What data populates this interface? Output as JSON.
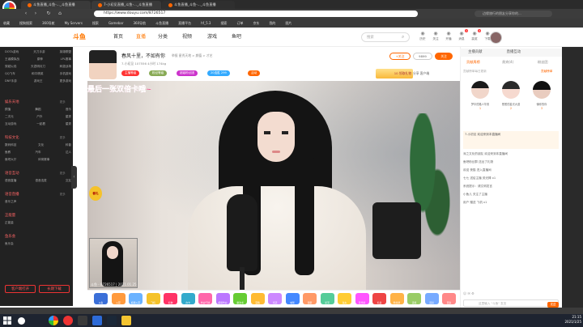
{
  "browser": {
    "tabs": [
      {
        "label": "斗鱼直播_斗鱼-..._斗鱼直播",
        "active": false
      },
      {
        "label": "斗鱼直播_斗鱼-..._斗鱼直播",
        "active": false
      },
      {
        "label": "7-小初见直播_斗鱼-..._斗鱼直播",
        "active": true
      },
      {
        "label": "斗鱼直播_斗鱼-..._斗鱼直播",
        "active": false
      }
    ],
    "url": "https://www.douyu.com/8726517",
    "search_placeholder": "边缘旅行的朋友分享你的...",
    "bookmarks": [
      "收藏",
      "搜狗搜索",
      "360导航",
      "My Servers",
      "搜索",
      "Gamebar",
      "360导航",
      "斗鱼直播",
      "直播平台",
      "hf_5.3",
      "搜索",
      "订单",
      "京东",
      "我的",
      "图片"
    ]
  },
  "site": {
    "logo": "斗鱼",
    "nav": [
      {
        "label": "首页",
        "active": false
      },
      {
        "label": "直播",
        "active": true
      },
      {
        "label": "分类",
        "active": false
      },
      {
        "label": "视频",
        "active": false
      },
      {
        "label": "游戏",
        "active": false
      },
      {
        "label": "鱼吧",
        "active": false
      }
    ],
    "search_placeholder": "搜索",
    "header_icons": [
      {
        "icon": "history-icon",
        "label": "历史"
      },
      {
        "icon": "follow-icon",
        "label": "关注"
      },
      {
        "icon": "live-icon",
        "label": "开播"
      },
      {
        "icon": "message-icon",
        "label": "消息",
        "badge": "1"
      },
      {
        "icon": "task-icon",
        "label": "赢奖",
        "badge": "4"
      },
      {
        "icon": "download-icon",
        "label": "下载"
      }
    ]
  },
  "left_sidebar": {
    "top_rows": [
      [
        "DOTA游戏",
        "天刀手游",
        "英雄联盟"
      ],
      [
        "王者模拟战",
        "原神",
        "LPL赛事"
      ],
      [
        "穿越火线",
        "天涯明月刀",
        "刺激战场"
      ],
      [
        "QQ飞车",
        "和平精英",
        "手机游戏"
      ],
      [
        "DNF手游",
        "游戏王",
        "更多游戏"
      ]
    ],
    "sections": [
      {
        "title": "娱乐天地",
        "more": "更多",
        "rows": [
          [
            "颜值",
            "舞蹈",
            "音乐"
          ],
          [
            "二次元",
            "户外",
            "星秀"
          ],
          [
            "互动游戏",
            "一起看",
            "星秀"
          ]
        ]
      },
      {
        "title": "科技文化",
        "more": "更多",
        "rows": [
          [
            "数码科技",
            "文化",
            "科普"
          ],
          [
            "鱼教",
            "汽车",
            "达人"
          ],
          [
            "鱼吧大厅",
            "体育赛事",
            ""
          ]
        ]
      },
      {
        "title": "语音互动",
        "more": "更多",
        "rows": [
          [
            "语音直播",
            "语音连麦",
            "交友"
          ]
        ]
      },
      {
        "title": "语音直播",
        "more": "更多",
        "rows": [
          [
            "音乐之声",
            "",
            ""
          ]
        ]
      },
      {
        "title": "正能量",
        "more": "",
        "rows": [
          [
            "正能量",
            "",
            ""
          ]
        ]
      },
      {
        "title": "鱼乐会",
        "more": "",
        "rows": [
          [
            "鱼乐会",
            "",
            ""
          ]
        ]
      }
    ],
    "btn_left": "客户端打开",
    "btn_right": "长期下载"
  },
  "room": {
    "title": "春风十里，不如有你",
    "category": "举报  星秀天地 > 颜值 > 才艺",
    "stats": [
      "7-小初见",
      "107556",
      "4小时",
      "174kg"
    ],
    "tags": [
      {
        "label": "主播等级",
        "color": "#f33"
      },
      {
        "label": "粉丝等级",
        "color": "#8a5"
      },
      {
        "label": "超级粉丝团",
        "color": "#c3c"
      },
      {
        "label": "20连胜 299",
        "color": "#3af"
      },
      {
        "label": "活动",
        "color": "#f60"
      }
    ],
    "report_label": "+关注",
    "fan_count": "9899",
    "follow_label": "关注",
    "share": "分享  客户端",
    "gold_label": "10  领取礼物",
    "overlay_text": "最后一张双倍卡哦~",
    "left_sticker": "春礼",
    "watermark": "斗鱼 - 8726517 | 2021.01.25"
  },
  "gifts": [
    {
      "label": "斗鱼",
      "color": "#3a6fd8"
    },
    {
      "label": "火箭",
      "color": "#ff9a3d"
    },
    {
      "label": "超级火箭",
      "color": "#6ab2ff"
    },
    {
      "label": "飞机",
      "color": "#f5c22a"
    },
    {
      "label": "礼物",
      "color": "#f36"
    },
    {
      "label": "办卡",
      "color": "#3ac"
    },
    {
      "label": "告白气球",
      "color": "#f6a"
    },
    {
      "label": "超级告白",
      "color": "#b7f"
    },
    {
      "label": "魔法书",
      "color": "#6c3"
    },
    {
      "label": "宝箱",
      "color": "#fb3"
    },
    {
      "label": "皇冠",
      "color": "#c8f"
    },
    {
      "label": "城堡",
      "color": "#48f"
    },
    {
      "label": "游艇",
      "color": "#f96"
    },
    {
      "label": "星河",
      "color": "#5c9"
    },
    {
      "label": "鱼丸",
      "color": "#fc3"
    },
    {
      "label": "荧光棒",
      "color": "#f5f"
    },
    {
      "label": "礼盒",
      "color": "#e44"
    },
    {
      "label": "粉丝牌",
      "color": "#ffb347"
    },
    {
      "label": "贵族",
      "color": "#9c6"
    },
    {
      "label": "道具",
      "color": "#7af"
    },
    {
      "label": "更多",
      "color": "#f88"
    }
  ],
  "right_panel": {
    "top_left": "主播贡献",
    "top_right": "直播互动",
    "tabs": [
      {
        "label": "贡献周榜",
        "active": true
      },
      {
        "label": "贵宾(4)",
        "active": false
      },
      {
        "label": "粉丝团",
        "active": false
      }
    ],
    "rank_info": "贡献榜单每日更新",
    "rank_link": "贡献榜单",
    "rank": [
      {
        "name": "梦中的路人华男",
        "score": "1"
      },
      {
        "name": "葱葱的星光大道",
        "score": "2"
      },
      {
        "name": "懂你的你",
        "score": "3"
      }
    ],
    "chat": [
      "7-小初见 欢迎来到本直播间",
      "深之文化的朋友 欢迎来到本直播间",
      "鱼吧粉丝群 送出了礼物",
      "欢迎 夜猫 进入直播间",
      "七七 送给主播 荧光棒 x1",
      "系统提示：请文明发言",
      "小鱼儿 关注了主播",
      "用户 赠送 飞机 x1"
    ],
    "chat_placeholder": "这里输入 \"斗鱼\" 发言",
    "send": "发送"
  },
  "taskbar": {
    "time": "21:15",
    "date": "2021/1/25"
  }
}
